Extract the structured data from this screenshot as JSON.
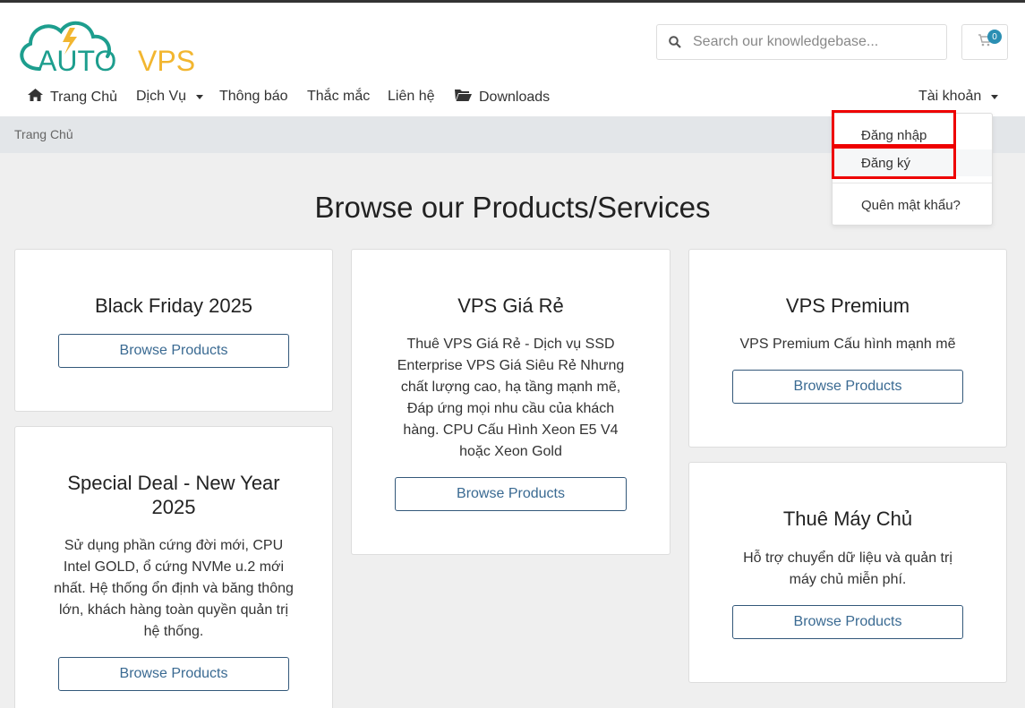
{
  "brand": {
    "logo_text_auto": "AUTO",
    "logo_text_vps": "VPS",
    "colors": {
      "teal": "#1d9e8e",
      "yellow": "#f2b630",
      "dark": "#333333"
    }
  },
  "search": {
    "placeholder": "Search our knowledgebase..."
  },
  "cart": {
    "count": "0"
  },
  "nav": {
    "home": "Trang Chủ",
    "services": "Dịch Vụ",
    "announcements": "Thông báo",
    "faq": "Thắc mắc",
    "contact": "Liên hệ",
    "downloads": "Downloads",
    "account": "Tài khoản"
  },
  "breadcrumb": {
    "current": "Trang Chủ"
  },
  "page": {
    "title": "Browse our Products/Services"
  },
  "account_menu": {
    "login": "Đăng nhập",
    "register": "Đăng ký",
    "forgot": "Quên mật khẩu?"
  },
  "products": [
    {
      "title": "Black Friday 2025",
      "description": "",
      "button": "Browse Products"
    },
    {
      "title": "Special Deal - New Year 2025",
      "description": "Sử dụng phần cứng đời mới, CPU Intel GOLD, ổ cứng NVMe u.2 mới nhất. Hệ thống ổn định và băng thông lớn, khách hàng toàn quyền quản trị hệ thống.",
      "button": "Browse Products"
    },
    {
      "title": "VPS Giá Rẻ",
      "description": "Thuê VPS Giá Rẻ - Dịch vụ SSD Enterprise VPS Giá Siêu Rẻ Nhưng chất lượng cao, hạ tầng mạnh mẽ, Đáp ứng mọi nhu cầu của khách hàng. CPU Cấu Hình Xeon E5 V4 hoặc Xeon Gold",
      "button": "Browse Products"
    },
    {
      "title": "VPS Premium",
      "description": "VPS Premium Cấu hình mạnh mẽ",
      "button": "Browse Products"
    },
    {
      "title": "Thuê Máy Chủ",
      "description": "Hỗ trợ chuyển dữ liệu và quản trị máy chủ miễn phí.",
      "button": "Browse Products"
    }
  ]
}
